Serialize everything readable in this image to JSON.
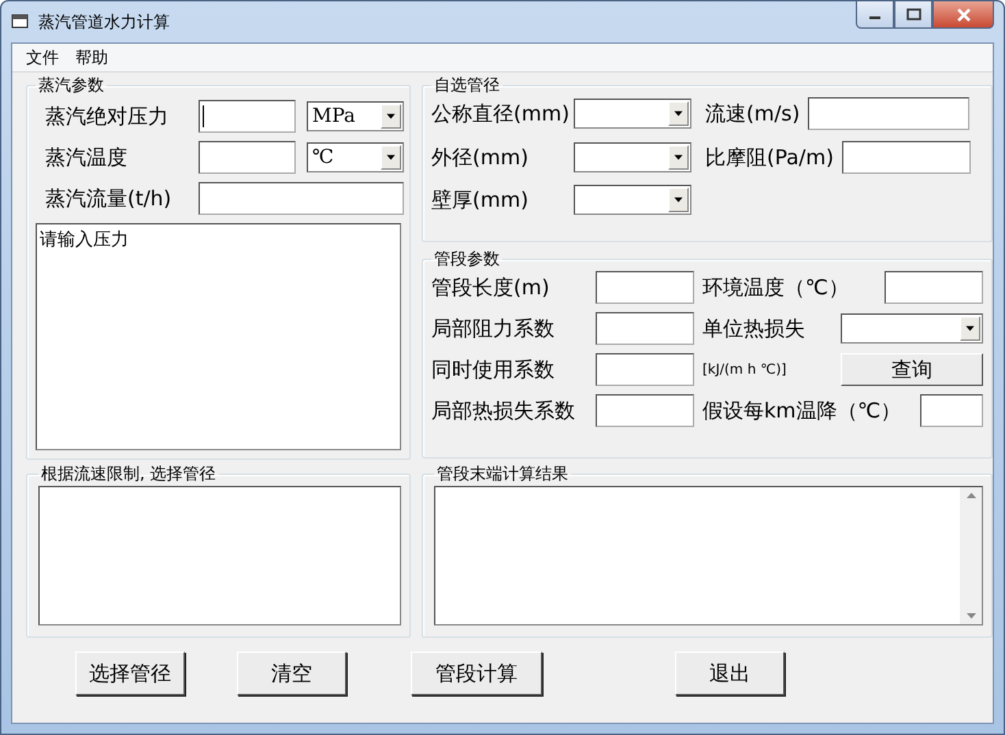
{
  "window": {
    "title": "蒸汽管道水力计算"
  },
  "menu": [
    {
      "label": "文件"
    },
    {
      "label": "帮助"
    }
  ],
  "steam_params": {
    "title": "蒸汽参数",
    "rows": [
      {
        "label": "蒸汽绝对压力",
        "controls": [
          {
            "kind": "text",
            "focused": true
          },
          {
            "kind": "select",
            "value": "MPa"
          }
        ]
      },
      {
        "label": "蒸汽温度",
        "controls": [
          {
            "kind": "text",
            "focused": false
          },
          {
            "kind": "select",
            "value": "℃"
          }
        ]
      },
      {
        "label": "蒸汽流量(t/h)",
        "controls": [
          {
            "kind": "wide",
            "focused": false
          }
        ]
      }
    ],
    "message": "请输入压力"
  },
  "custom_pipe": {
    "title": "自选管径",
    "rows": [
      [
        {
          "label": "公称直径(mm)",
          "kind": "select"
        },
        {
          "label": "流速(m/s)",
          "kind": "text"
        }
      ],
      [
        {
          "label": "外径(mm)",
          "kind": "select"
        },
        {
          "label": "比摩阻(Pa/m)",
          "kind": "text"
        }
      ],
      [
        {
          "label": "壁厚(mm)",
          "kind": "select"
        }
      ]
    ]
  },
  "segment_params": {
    "title": "管段参数",
    "rows": [
      [
        {
          "label": "管段长度(m)",
          "kind": "text"
        },
        {
          "label": "环境温度（℃）",
          "kind": "text"
        }
      ],
      [
        {
          "label": "局部阻力系数",
          "kind": "text"
        },
        {
          "label": "单位热损失",
          "kind": "select"
        }
      ],
      [
        {
          "label": "同时使用系数",
          "kind": "text"
        },
        {
          "label": "[kJ/(m h ℃)]",
          "kind": "button",
          "text": "查询"
        }
      ],
      [
        {
          "label": "局部热损失系数",
          "kind": "text"
        },
        {
          "label": "假设每km温降（℃）",
          "kind": "short"
        }
      ]
    ]
  },
  "pipe_selection": {
    "title": "根据流速限制, 选择管径"
  },
  "results": {
    "title": "管段末端计算结果"
  },
  "buttons": [
    {
      "label": "选择管径"
    },
    {
      "label": "清空"
    },
    {
      "label": "管段计算"
    },
    {
      "label": "退出"
    }
  ]
}
